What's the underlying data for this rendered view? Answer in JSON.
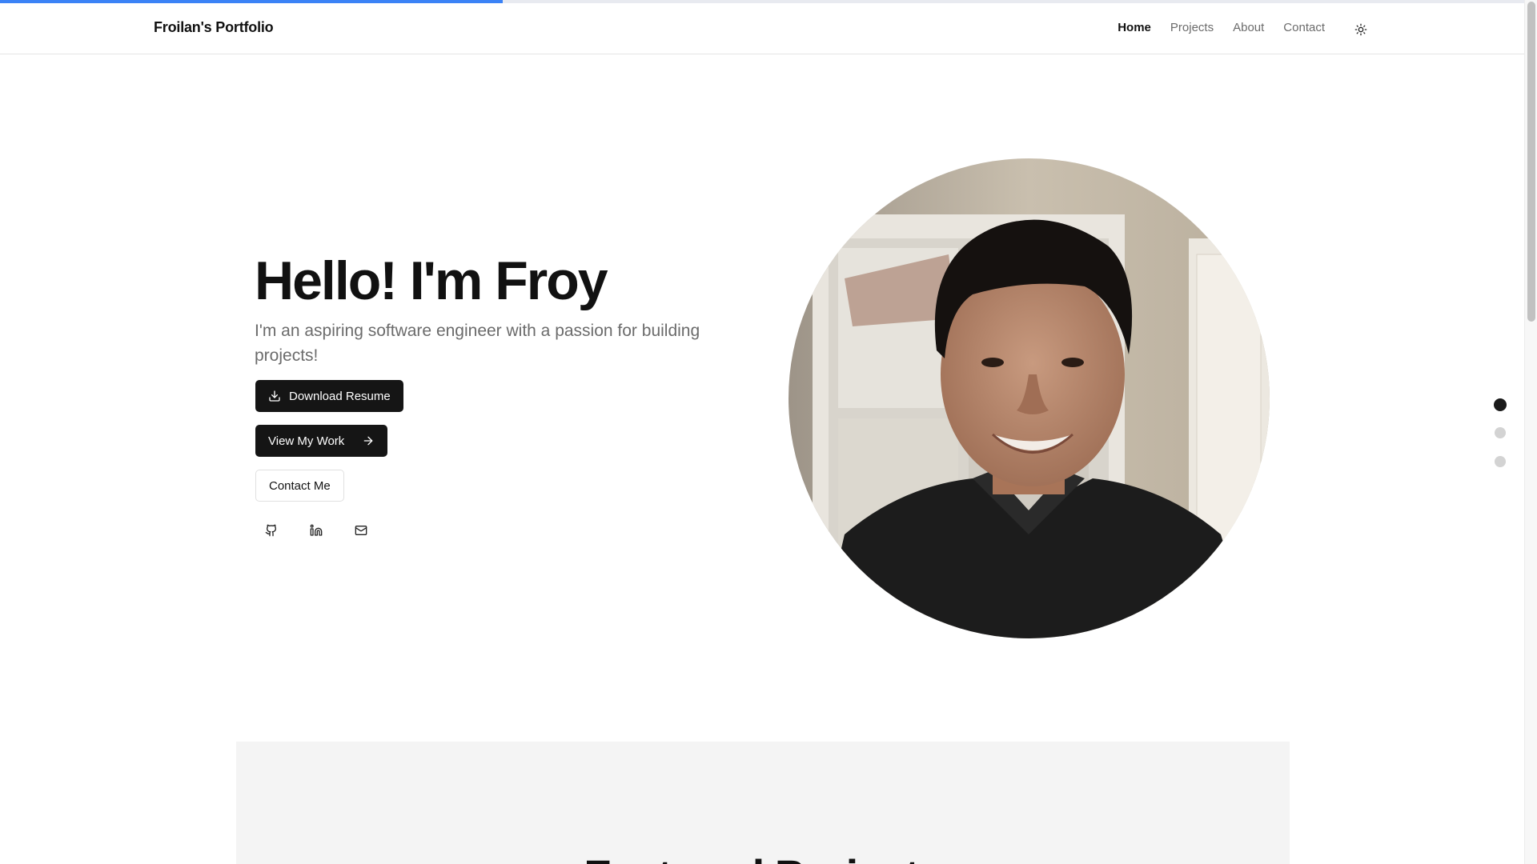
{
  "progress": {
    "value_percent": 33,
    "color": "#3b82f6"
  },
  "header": {
    "brand": "Froilan's Portfolio",
    "nav": [
      {
        "label": "Home",
        "active": true
      },
      {
        "label": "Projects",
        "active": false
      },
      {
        "label": "About",
        "active": false
      },
      {
        "label": "Contact",
        "active": false
      }
    ],
    "theme_toggle_icon": "sun-icon"
  },
  "hero": {
    "title": "Hello! I'm Froy",
    "subtitle": "I'm an aspiring software engineer with a passion for building projects!",
    "buttons": {
      "download": "Download Resume",
      "work": "View My Work",
      "contact": "Contact Me"
    },
    "social_icons": [
      "github-icon",
      "linkedin-icon",
      "mail-icon"
    ]
  },
  "section_nav": {
    "count": 3,
    "active_index": 0
  },
  "projects": {
    "title": "Featured Projects"
  }
}
